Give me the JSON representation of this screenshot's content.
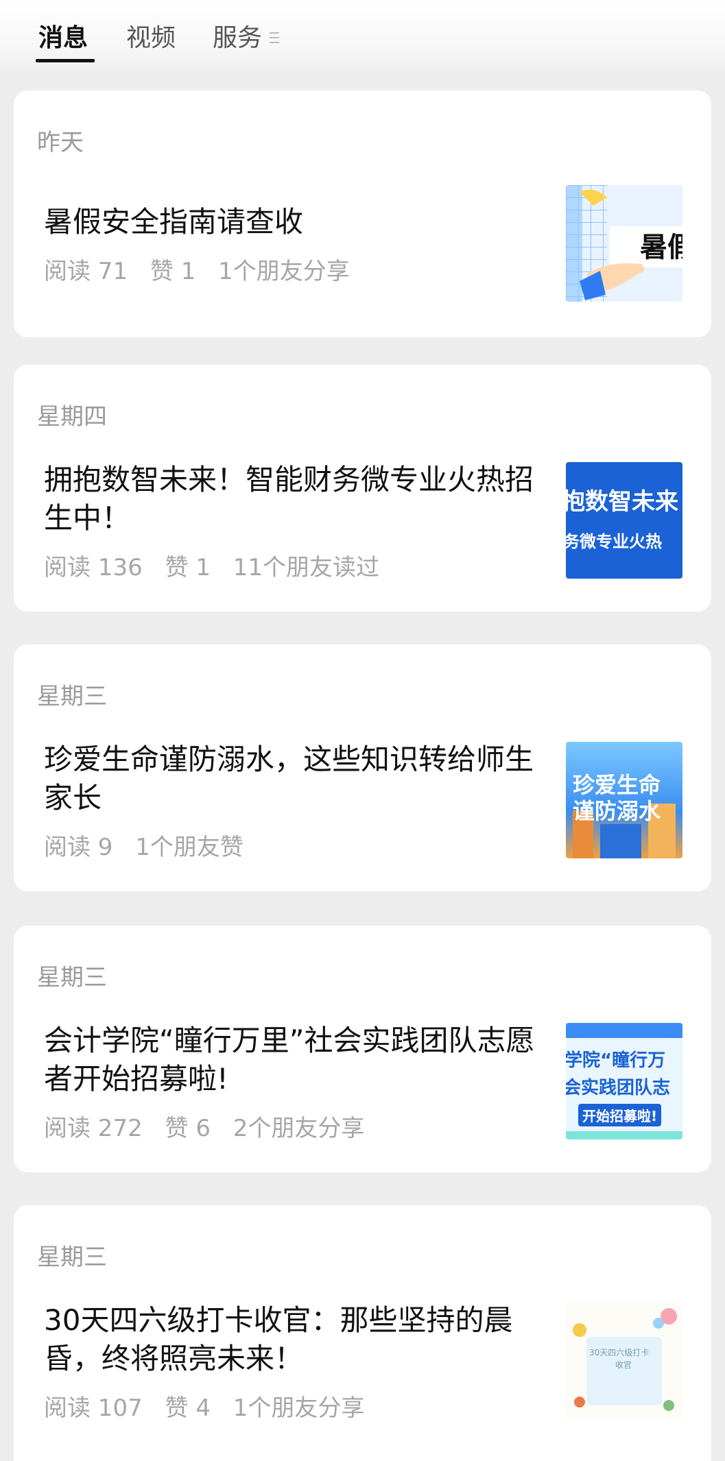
{
  "tabs": [
    {
      "label": "消息"
    },
    {
      "label": "视频"
    },
    {
      "label": "服务"
    }
  ],
  "articles": [
    {
      "day": "昨天",
      "title": "暑假安全指南请查收",
      "stats": [
        "阅读 71",
        "赞 1",
        "1个朋友分享"
      ],
      "thumb_text": "暑假"
    },
    {
      "day": "星期四",
      "title": "拥抱数智未来！智能财务微专业火热招生中！",
      "stats": [
        "阅读 136",
        "赞 1",
        "11个朋友读过"
      ],
      "thumb_text": [
        "抱数智未来",
        "务微专业火热"
      ]
    },
    {
      "day": "星期三",
      "title": "珍爱生命谨防溺水，这些知识转给师生家长",
      "stats": [
        "阅读 9",
        "1个朋友赞"
      ],
      "thumb_text": [
        "珍爱生命",
        "谨防溺水"
      ]
    },
    {
      "day": "星期三",
      "title": "会计学院“瞳行万里”社会实践团队志愿者开始招募啦!",
      "stats": [
        "阅读 272",
        "赞 6",
        "2个朋友分享"
      ],
      "thumb_text": [
        "学院“瞳行万",
        "会实践团队志",
        "开始招募啦!"
      ]
    },
    {
      "day": "星期三",
      "title": "30天四六级打卡收官：那些坚持的晨昏，终将照亮未来！",
      "stats": [
        "阅读 107",
        "赞 4",
        "1个朋友分享"
      ],
      "thumb_text": [
        "30天四六级打卡",
        "收官"
      ]
    }
  ],
  "colors": {
    "background": "#ededed",
    "card": "#ffffff",
    "muted": "#9a9a9a",
    "text": "#111111",
    "accent_blue": "#1a62d6"
  }
}
